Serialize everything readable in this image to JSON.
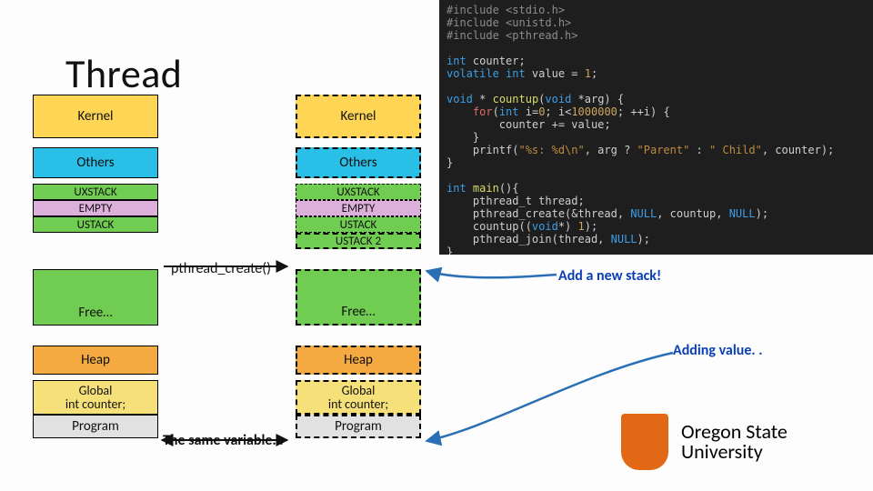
{
  "title": "Thread",
  "stack_left": {
    "kernel": "Kernel",
    "others": "Others",
    "uxstack": "UXSTACK",
    "empty": "EMPTY",
    "ustack": "USTACK",
    "free": "Free…",
    "heap": "Heap",
    "global_l1": "Global",
    "global_l2": "int counter;",
    "program": "Program"
  },
  "stack_right": {
    "kernel": "Kernel",
    "others": "Others",
    "uxstack": "UXSTACK",
    "empty": "EMPTY",
    "ustack": "USTACK",
    "ustack2": "USTACK 2",
    "free": "Free…",
    "heap": "Heap",
    "global_l1": "Global",
    "global_l2": "int counter;",
    "program": "Program"
  },
  "labels": {
    "pthread_create": "pthread_create()",
    "same_variable": "The same variable. .",
    "add_stack": "Add a new stack!",
    "add_value": "Adding value. ."
  },
  "code": {
    "l01": "#include <stdio.h>",
    "l02": "#include <unistd.h>",
    "l03": "#include <pthread.h>",
    "l04": "",
    "l05a": "int",
    "l05b": " counter;",
    "l06a": "volatile int",
    "l06b": " value = ",
    "l06c": "1",
    "l06d": ";",
    "l07": "",
    "l08a": "void",
    "l08b": " * ",
    "l08c": "countup",
    "l08d": "(",
    "l08e": "void",
    "l08f": " *arg) {",
    "l09a": "    for",
    "l09b": "(",
    "l09c": "int",
    "l09d": " i=",
    "l09e": "0",
    "l09f": "; i<",
    "l09g": "1000000",
    "l09h": "; ++i) {",
    "l10": "        counter += value;",
    "l11": "    }",
    "l12a": "    printf(",
    "l12b": "\"%s: %d\\n\"",
    "l12c": ", arg ? ",
    "l12d": "\"Parent\"",
    "l12e": " : ",
    "l12f": "\" Child\"",
    "l12g": ", counter);",
    "l13": "}",
    "l14": "",
    "l15a": "int",
    "l15b": " ",
    "l15c": "main",
    "l15d": "(){",
    "l16": "    pthread_t thread;",
    "l17a": "    pthread_create(&thread, ",
    "l17b": "NULL",
    "l17c": ", countup, ",
    "l17d": "NULL",
    "l17e": ");",
    "l18a": "    countup((",
    "l18b": "void",
    "l18c": "*) ",
    "l18d": "1",
    "l18e": ");",
    "l19a": "    pthread_join(thread, ",
    "l19b": "NULL",
    "l19c": ");",
    "l20": "}"
  },
  "logo": {
    "line1": "Oregon State",
    "line2": "University"
  }
}
